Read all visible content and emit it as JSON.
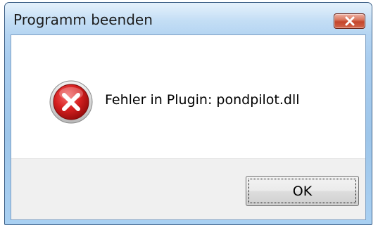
{
  "dialog": {
    "title": "Programm beenden",
    "message": "Fehler in Plugin: pondpilot.dll",
    "ok_label": "OK",
    "icon": "error-icon"
  },
  "colors": {
    "title_bar": "#a9cdef",
    "close_button": "#c4462c",
    "error_icon": "#d01f1f",
    "button_area": "#f0f0f0"
  }
}
